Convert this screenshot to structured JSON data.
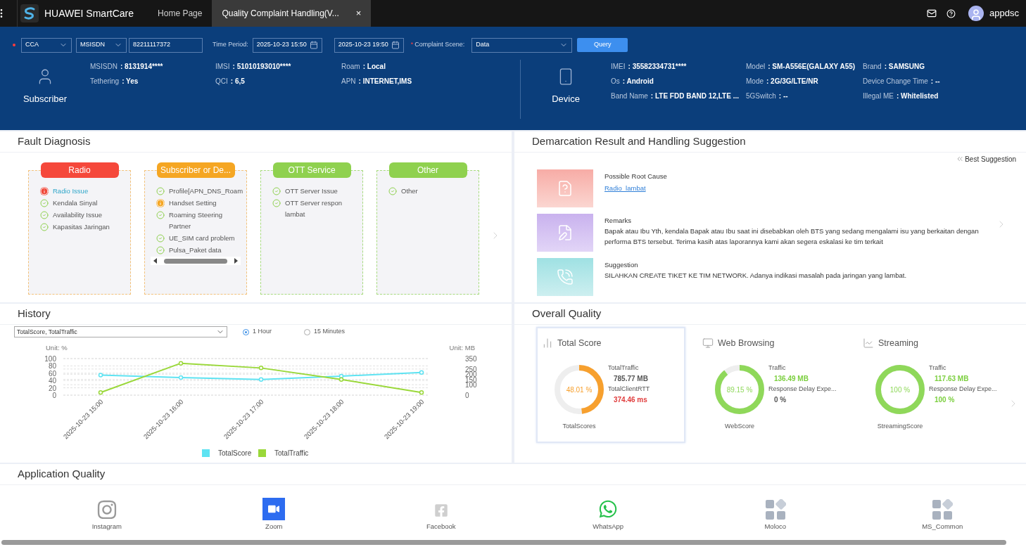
{
  "topbar": {
    "brand": "HUAWEI SmartCare",
    "tabs": [
      {
        "label": "Home Page",
        "selected": false,
        "closable": false
      },
      {
        "label": "Quality Complaint Handling(V...",
        "selected": true,
        "closable": true
      }
    ],
    "close": "×",
    "user": "appdsc"
  },
  "query": {
    "type_select": "CCA",
    "id_select": "MSISDN",
    "id_value": "82211117372",
    "time_label": "Time Period:",
    "start": "2025-10-23 15:50",
    "end": "2025-10-23 19:50",
    "required_mark": "*",
    "scene_label": "Complaint Scene:",
    "scene": "Data",
    "button": "Query"
  },
  "subscriber": {
    "title": "Subscriber",
    "fields": [
      {
        "label": "MSISDN",
        "value": ": 8131914****"
      },
      {
        "label": "IMSI",
        "value": ": 51010193010****"
      },
      {
        "label": "Roam",
        "value": ": Local"
      },
      {
        "label": "Tethering",
        "value": ": Yes"
      },
      {
        "label": "QCI",
        "value": ": 6,5"
      },
      {
        "label": "APN",
        "value": ": INTERNET,IMS"
      }
    ]
  },
  "device": {
    "title": "Device",
    "fields": [
      {
        "label": "IMEI",
        "value": ": 35582334731****"
      },
      {
        "label": "Model",
        "value": ": SM-A556E(GALAXY A55)"
      },
      {
        "label": "Brand",
        "value": ": SAMSUNG"
      },
      {
        "label": "Os",
        "value": ": Android"
      },
      {
        "label": "Mode",
        "value": ": 2G/3G/LTE/NR"
      },
      {
        "label": "Device Change Time",
        "value": ": --"
      },
      {
        "label": "Band Name",
        "value": ": LTE FDD BAND 12,LTE ..."
      },
      {
        "label": "5GSwitch",
        "value": ": --"
      },
      {
        "label": "Illegal ME",
        "value": ": Whitelisted"
      }
    ]
  },
  "fault_diagnosis": {
    "title": "Fault Diagnosis",
    "columns": [
      {
        "title": "Radio",
        "color": "#f5483b",
        "scrollbar": false,
        "items": [
          {
            "label": "Radio Issue",
            "kind": "error"
          },
          {
            "label": "Kendala Sinyal",
            "kind": "ok"
          },
          {
            "label": "Availability Issue",
            "kind": "ok"
          },
          {
            "label": "Kapasitas Jaringan",
            "kind": "ok"
          }
        ]
      },
      {
        "title": "Subscriber or De...",
        "color": "#f5a623",
        "scrollbar": true,
        "items": [
          {
            "label": "Profile[APN_DNS_Roam",
            "kind": "ok"
          },
          {
            "label": "Handset Setting",
            "kind": "warning"
          },
          {
            "label": "Roaming Steering Partner",
            "kind": "ok"
          },
          {
            "label": "UE_SIM card problem",
            "kind": "ok"
          },
          {
            "label": "Pulsa_Paket data",
            "kind": "ok"
          }
        ]
      },
      {
        "title": "OTT Service",
        "color": "#8fd14f",
        "scrollbar": false,
        "items": [
          {
            "label": "OTT Server Issue",
            "kind": "ok"
          },
          {
            "label": "OTT Server respon lambat",
            "kind": "ok"
          }
        ]
      },
      {
        "title": "Other",
        "color": "#8fd14f",
        "scrollbar": false,
        "items": [
          {
            "label": "Other",
            "kind": "ok"
          }
        ]
      }
    ]
  },
  "demarcation": {
    "title": "Demarcation Result and Handling Suggestion",
    "best": "Best Suggestion",
    "rows": [
      {
        "kind": "cause",
        "title": "Possible Root Cause",
        "link": "Radio_lambat"
      },
      {
        "kind": "remarks",
        "title": "Remarks",
        "text": "Bapak atau Ibu Yth, kendala Bapak atau Ibu saat ini disebabkan oleh BTS yang sedang mengalami isu yang berkaitan dengan performa BTS tersebut. Terima kasih atas laporannya kami akan segera eskalasi ke tim terkait"
      },
      {
        "kind": "suggestion",
        "title": "Suggestion",
        "text": "SILAHKAN CREATE TIKET KE TIM NETWORK. Adanya indikasi masalah pada jaringan yang lambat."
      }
    ]
  },
  "history": {
    "title": "History",
    "metric_select": "TotalScore, TotalTraffic",
    "radios": [
      {
        "label": "1 Hour",
        "selected": true
      },
      {
        "label": "15 Minutes",
        "selected": false
      }
    ],
    "chart_data": {
      "type": "line",
      "ylabel": "Unit: %",
      "y2label": "Unit: MB",
      "categories": [
        "2025-10-23 15:00",
        "2025-10-23 16:00",
        "2025-10-23 17:00",
        "2025-10-23 18:00",
        "2025-10-23 19:00"
      ],
      "grid": true,
      "legend": true,
      "yticks": [
        0,
        20,
        40,
        60,
        80,
        100
      ],
      "y2ticks": [
        0,
        100,
        150,
        200,
        250,
        350
      ],
      "ylim": [
        0,
        100
      ],
      "y2lim": [
        0,
        350
      ],
      "series": [
        {
          "name": "TotalScore",
          "color": "#5ee3f2",
          "marker": "circle",
          "values": [
            55,
            48,
            43,
            52,
            62
          ]
        },
        {
          "name": "TotalTraffic",
          "color": "#9ad83a",
          "axis": "y2",
          "marker": "circle",
          "values": [
            25,
            305,
            260,
            150,
            25
          ]
        }
      ]
    }
  },
  "overall": {
    "title": "Overall Quality",
    "cards": [
      {
        "kind": "bars",
        "title": "Total Score",
        "selected": true,
        "score": "48.01 %",
        "color": "#f7a02e",
        "score_label": "TotalScores",
        "metrics": [
          {
            "label": "TotalTraffic",
            "value": "785.77 MB",
            "color": "#555555"
          },
          {
            "label": "TotalClientRTT",
            "value": "374.46 ms",
            "color": "#e03c3c"
          }
        ]
      },
      {
        "kind": "monitor",
        "title": "Web Browsing",
        "selected": false,
        "score": "89.15 %",
        "color": "#8fd85a",
        "score_label": "WebScore",
        "metrics": [
          {
            "label": "Traffic",
            "value": "136.49 MB",
            "color": "#7ccf3f"
          },
          {
            "label": "Response Delay Expe...",
            "value": "0 %",
            "color": "#555555"
          }
        ]
      },
      {
        "kind": "trend",
        "title": "Streaming",
        "selected": false,
        "score": "100 %",
        "color": "#8fd85a",
        "score_label": "StreamingScore",
        "metrics": [
          {
            "label": "Traffic",
            "value": "117.63 MB",
            "color": "#7ccf3f"
          },
          {
            "label": "Response Delay Expe...",
            "value": "100 %",
            "color": "#7ccf3f"
          }
        ]
      }
    ]
  },
  "app_quality": {
    "title": "Application Quality",
    "apps": [
      {
        "kind": "instagram",
        "name": "Instagram"
      },
      {
        "kind": "zoom",
        "name": "Zoom"
      },
      {
        "kind": "facebook",
        "name": "Facebook"
      },
      {
        "kind": "whatsapp",
        "name": "WhatsApp"
      },
      {
        "kind": "grid",
        "name": "Moloco"
      },
      {
        "kind": "grid",
        "name": "MS_Common"
      }
    ]
  }
}
